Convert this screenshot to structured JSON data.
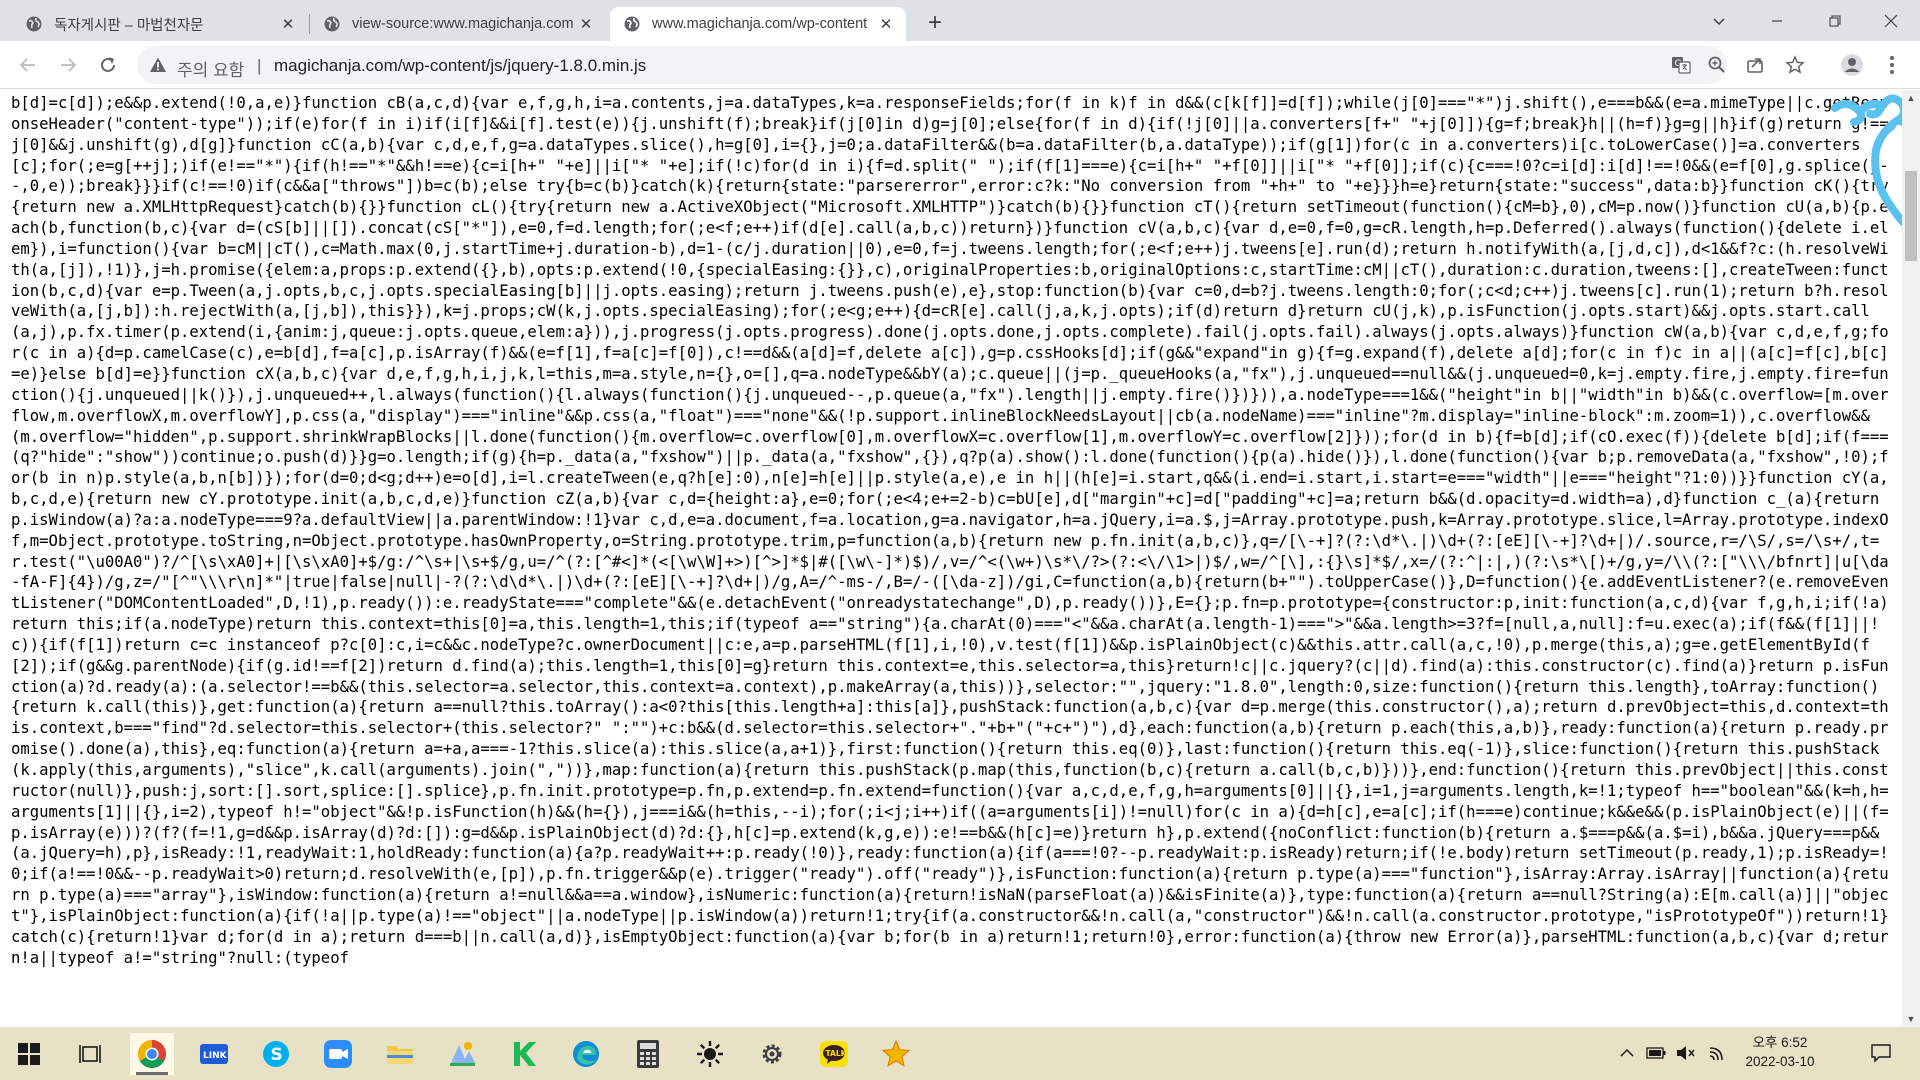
{
  "tabs": [
    {
      "title": "독자게시판 – 마법천자문",
      "close": "✕",
      "active": false
    },
    {
      "title": "view-source:www.magichanja.com",
      "close": "✕",
      "active": false
    },
    {
      "title": "www.magichanja.com/wp-content",
      "close": "✕",
      "active": true
    }
  ],
  "new_tab": "+",
  "address_bar": {
    "security_label": "주의 요함",
    "divider": "|",
    "url": "magichanja.com/wp-content/js/jquery-1.8.0.min.js"
  },
  "source_code": "b[d]=c[d]);e&&p.extend(!0,a,e)}function cB(a,c,d){var e,f,g,h,i=a.contents,j=a.dataTypes,k=a.responseFields;for(f in k)f in d&&(c[k[f]]=d[f]);while(j[0]===\"*\")j.shift(),e===b&&(e=a.mimeType||c.getResponseHeader(\"content-type\"));if(e)for(f in i)if(i[f]&&i[f].test(e)){j.unshift(f);break}if(j[0]in d)g=j[0];else{for(f in d){if(!j[0]||a.converters[f+\" \"+j[0]]){g=f;break}h||(h=f)}g=g||h}if(g)return g!==j[0]&&j.unshift(g),d[g]}function cC(a,b){var c,d,e,f,g=a.dataTypes.slice(),h=g[0],i={},j=0;a.dataFilter&&(b=a.dataFilter(b,a.dataType));if(g[1])for(c in a.converters)i[c.toLowerCase()]=a.converters[c];for(;e=g[++j];)if(e!==\"*\"){if(h!==\"*\"&&h!==e){c=i[h+\" \"+e]||i[\"* \"+e];if(!c)for(d in i){f=d.split(\" \");if(f[1]===e){c=i[h+\" \"+f[0]]||i[\"* \"+f[0]];if(c){c===!0?c=i[d]:i[d]!==!0&&(e=f[0],g.splice(j--,0,e));break}}}if(c!==!0)if(c&&a[\"throws\"])b=c(b);else try{b=c(b)}catch(k){return{state:\"parsererror\",error:c?k:\"No conversion from \"+h+\" to \"+e}}}h=e}return{state:\"success\",data:b}}function cK(){try{return new a.XMLHttpRequest}catch(b){}}function cL(){try{return new a.ActiveXObject(\"Microsoft.XMLHTTP\")}catch(b){}}function cT(){return setTimeout(function(){cM=b},0),cM=p.now()}function cU(a,b){p.each(b,function(b,c){var d=(cS[b]||[]).concat(cS[\"*\"]),e=0,f=d.length;for(;e<f;e++)if(d[e].call(a,b,c))return})}function cV(a,b,c){var d,e=0,f=0,g=cR.length,h=p.Deferred().always(function(){delete i.elem}),i=function(){var b=cM||cT(),c=Math.max(0,j.startTime+j.duration-b),d=1-(c/j.duration||0),e=0,f=j.tweens.length;for(;e<f;e++)j.tweens[e].run(d);return h.notifyWith(a,[j,d,c]),d<1&&f?c:(h.resolveWith(a,[j]),!1)},j=h.promise({elem:a,props:p.extend({},b),opts:p.extend(!0,{specialEasing:{}},c),originalProperties:b,originalOptions:c,startTime:cM||cT(),duration:c.duration,tweens:[],createTween:function(b,c,d){var e=p.Tween(a,j.opts,b,c,j.opts.specialEasing[b]||j.opts.easing);return j.tweens.push(e),e},stop:function(b){var c=0,d=b?j.tweens.length:0;for(;c<d;c++)j.tweens[c].run(1);return b?h.resolveWith(a,[j,b]):h.rejectWith(a,[j,b]),this}}),k=j.props;cW(k,j.opts.specialEasing);for(;e<g;e++){d=cR[e].call(j,a,k,j.opts);if(d)return d}return cU(j,k),p.isFunction(j.opts.start)&&j.opts.start.call(a,j),p.fx.timer(p.extend(i,{anim:j,queue:j.opts.queue,elem:a})),j.progress(j.opts.progress).done(j.opts.done,j.opts.complete).fail(j.opts.fail).always(j.opts.always)}function cW(a,b){var c,d,e,f,g;for(c in a){d=p.camelCase(c),e=b[d],f=a[c],p.isArray(f)&&(e=f[1],f=a[c]=f[0]),c!==d&&(a[d]=f,delete a[c]),g=p.cssHooks[d];if(g&&\"expand\"in g){f=g.expand(f),delete a[d];for(c in f)c in a||(a[c]=f[c],b[c]=e)}else b[d]=e}}function cX(a,b,c){var d,e,f,g,h,i,j,k,l=this,m=a.style,n={},o=[],q=a.nodeType&&bY(a);c.queue||(j=p._queueHooks(a,\"fx\"),j.unqueued==null&&(j.unqueued=0,k=j.empty.fire,j.empty.fire=function(){j.unqueued||k()}),j.unqueued++,l.always(function(){l.always(function(){j.unqueued--,p.queue(a,\"fx\").length||j.empty.fire()})})),a.nodeType===1&&(\"height\"in b||\"width\"in b)&&(c.overflow=[m.overflow,m.overflowX,m.overflowY],p.css(a,\"display\")===\"inline\"&&p.css(a,\"float\")===\"none\"&&(!p.support.inlineBlockNeedsLayout||cb(a.nodeName)===\"inline\"?m.display=\"inline-block\":m.zoom=1)),c.overflow&&(m.overflow=\"hidden\",p.support.shrinkWrapBlocks||l.done(function(){m.overflow=c.overflow[0],m.overflowX=c.overflow[1],m.overflowY=c.overflow[2]}));for(d in b){f=b[d];if(cO.exec(f)){delete b[d];if(f===(q?\"hide\":\"show\"))continue;o.push(d)}}g=o.length;if(g){h=p._data(a,\"fxshow\")||p._data(a,\"fxshow\",{}),q?p(a).show():l.done(function(){p(a).hide()}),l.done(function(){var b;p.removeData(a,\"fxshow\",!0);for(b in n)p.style(a,b,n[b])});for(d=0;d<g;d++)e=o[d],i=l.createTween(e,q?h[e]:0),n[e]=h[e]||p.style(a,e),e in h||(h[e]=i.start,q&&(i.end=i.start,i.start=e===\"width\"||e===\"height\"?1:0))}}function cY(a,b,c,d,e){return new cY.prototype.init(a,b,c,d,e)}function cZ(a,b){var c,d={height:a},e=0;for(;e<4;e+=2-b)c=bU[e],d[\"margin\"+c]=d[\"padding\"+c]=a;return b&&(d.opacity=d.width=a),d}function c_(a){return p.isWindow(a)?a:a.nodeType===9?a.defaultView||a.parentWindow:!1}var c,d,e=a.document,f=a.location,g=a.navigator,h=a.jQuery,i=a.$,j=Array.prototype.push,k=Array.prototype.slice,l=Array.prototype.indexOf,m=Object.prototype.toString,n=Object.prototype.hasOwnProperty,o=String.prototype.trim,p=function(a,b){return new p.fn.init(a,b,c)},q=/[\\-+]?(?:\\d*\\.|)\\d+(?:[eE][\\-+]?\\d+|)/.source,r=/\\S/,s=/\\s+/,t=r.test(\"\\u00A0\")?/^[\\s\\xA0]+|[\\s\\xA0]+$/g:/^\\s+|\\s+$/g,u=/^(?:[^#<]*(<[\\w\\W]+>)[^>]*$|#([\\w\\-]*)$)/,v=/^<(\\w+)\\s*\\/?>(?:<\\/\\1>|)$/,w=/^[\\],:{}\\s]*$/,x=/(?:^|:|,)(?:\\s*\\[)+/g,y=/\\\\(?:[\"\\\\\\/bfnrt]|u[\\da-fA-F]{4})/g,z=/\"[^\"\\\\\\r\\n]*\"|true|false|null|-?(?:\\d\\d*\\.|)\\d+(?:[eE][\\-+]?\\d+|)/g,A=/^-ms-/,B=/-([\\da-z])/gi,C=function(a,b){return(b+\"\").toUpperCase()},D=function(){e.addEventListener?(e.removeEventListener(\"DOMContentLoaded\",D,!1),p.ready()):e.readyState===\"complete\"&&(e.detachEvent(\"onreadystatechange\",D),p.ready())},E={};p.fn=p.prototype={constructor:p,init:function(a,c,d){var f,g,h,i;if(!a)return this;if(a.nodeType)return this.context=this[0]=a,this.length=1,this;if(typeof a==\"string\"){a.charAt(0)===\"<\"&&a.charAt(a.length-1)===\">\"&&a.length>=3?f=[null,a,null]:f=u.exec(a);if(f&&(f[1]||!c)){if(f[1])return c=c instanceof p?c[0]:c,i=c&&c.nodeType?c.ownerDocument||c:e,a=p.parseHTML(f[1],i,!0),v.test(f[1])&&p.isPlainObject(c)&&this.attr.call(a,c,!0),p.merge(this,a);g=e.getElementById(f[2]);if(g&&g.parentNode){if(g.id!==f[2])return d.find(a);this.length=1,this[0]=g}return this.context=e,this.selector=a,this}return!c||c.jquery?(c||d).find(a):this.constructor(c).find(a)}return p.isFunction(a)?d.ready(a):(a.selector!==b&&(this.selector=a.selector,this.context=a.context),p.makeArray(a,this))},selector:\"\",jquery:\"1.8.0\",length:0,size:function(){return this.length},toArray:function(){return k.call(this)},get:function(a){return a==null?this.toArray():a<0?this[this.length+a]:this[a]},pushStack:function(a,b,c){var d=p.merge(this.constructor(),a);return d.prevObject=this,d.context=this.context,b===\"find\"?d.selector=this.selector+(this.selector?\" \":\"\")+c:b&&(d.selector=this.selector+\".\"+b+\"(\"+c+\")\"),d},each:function(a,b){return p.each(this,a,b)},ready:function(a){return p.ready.promise().done(a),this},eq:function(a){return a=+a,a===-1?this.slice(a):this.slice(a,a+1)},first:function(){return this.eq(0)},last:function(){return this.eq(-1)},slice:function(){return this.pushStack(k.apply(this,arguments),\"slice\",k.call(arguments).join(\",\"))},map:function(a){return this.pushStack(p.map(this,function(b,c){return a.call(b,c,b)}))},end:function(){return this.prevObject||this.constructor(null)},push:j,sort:[].sort,splice:[].splice},p.fn.init.prototype=p.fn,p.extend=p.fn.extend=function(){var a,c,d,e,f,g,h=arguments[0]||{},i=1,j=arguments.length,k=!1;typeof h==\"boolean\"&&(k=h,h=arguments[1]||{},i=2),typeof h!=\"object\"&&!p.isFunction(h)&&(h={}),j===i&&(h=this,--i);for(;i<j;i++)if((a=arguments[i])!=null)for(c in a){d=h[c],e=a[c];if(h===e)continue;k&&e&&(p.isPlainObject(e)||(f=p.isArray(e)))?(f?(f=!1,g=d&&p.isArray(d)?d:[]):g=d&&p.isPlainObject(d)?d:{},h[c]=p.extend(k,g,e)):e!==b&&(h[c]=e)}return h},p.extend({noConflict:function(b){return a.$===p&&(a.$=i),b&&a.jQuery===p&&(a.jQuery=h),p},isReady:!1,readyWait:1,holdReady:function(a){a?p.readyWait++:p.ready(!0)},ready:function(a){if(a===!0?--p.readyWait:p.isReady)return;if(!e.body)return setTimeout(p.ready,1);p.isReady=!0;if(a!==!0&&--p.readyWait>0)return;d.resolveWith(e,[p]),p.fn.trigger&&p(e).trigger(\"ready\").off(\"ready\")},isFunction:function(a){return p.type(a)===\"function\"},isArray:Array.isArray||function(a){return p.type(a)===\"array\"},isWindow:function(a){return a!=null&&a==a.window},isNumeric:function(a){return!isNaN(parseFloat(a))&&isFinite(a)},type:function(a){return a==null?String(a):E[m.call(a)]||\"object\"},isPlainObject:function(a){if(!a||p.type(a)!==\"object\"||a.nodeType||p.isWindow(a))return!1;try{if(a.constructor&&!n.call(a,\"constructor\")&&!n.call(a.constructor.prototype,\"isPrototypeOf\"))return!1}catch(c){return!1}var d;for(d in a);return d===b||n.call(a,d)},isEmptyObject:function(a){var b;for(b in a)return!1;return!0},error:function(a){throw new Error(a)},parseHTML:function(a,b,c){var d;return!a||typeof a!=\"string\"?null:(typeof",
  "scrollbar": {
    "up_arrow": "▲",
    "down_arrow": "▼",
    "position": 0.08
  },
  "taskbar": {
    "apps": [
      {
        "name": "start",
        "icon": "windows-logo"
      },
      {
        "name": "task-view",
        "icon": "task-view-icon"
      },
      {
        "name": "chrome",
        "icon": "chrome-icon",
        "active": true
      },
      {
        "name": "app-blue",
        "icon": "app-icon"
      },
      {
        "name": "skype",
        "icon": "skype-icon"
      },
      {
        "name": "zoom",
        "icon": "zoom-icon"
      },
      {
        "name": "file-explorer",
        "icon": "folder-icon"
      },
      {
        "name": "paint",
        "icon": "paint-icon"
      },
      {
        "name": "app-green",
        "icon": "k-app-icon"
      },
      {
        "name": "edge",
        "icon": "edge-icon"
      },
      {
        "name": "calculator",
        "icon": "calculator-icon"
      },
      {
        "name": "brightness",
        "icon": "sun-icon"
      },
      {
        "name": "settings",
        "icon": "gear-icon"
      },
      {
        "name": "kakaotalk",
        "icon": "kakaotalk-icon",
        "label": "TALK"
      },
      {
        "name": "favorites",
        "icon": "star-icon"
      }
    ],
    "clock_time": "오후 6:52",
    "clock_date": "2022-03-10"
  },
  "colors": {
    "tab_strip": "#dee1e6",
    "taskbar": "#e7e1c6",
    "doodle": "#5bc2f0"
  }
}
